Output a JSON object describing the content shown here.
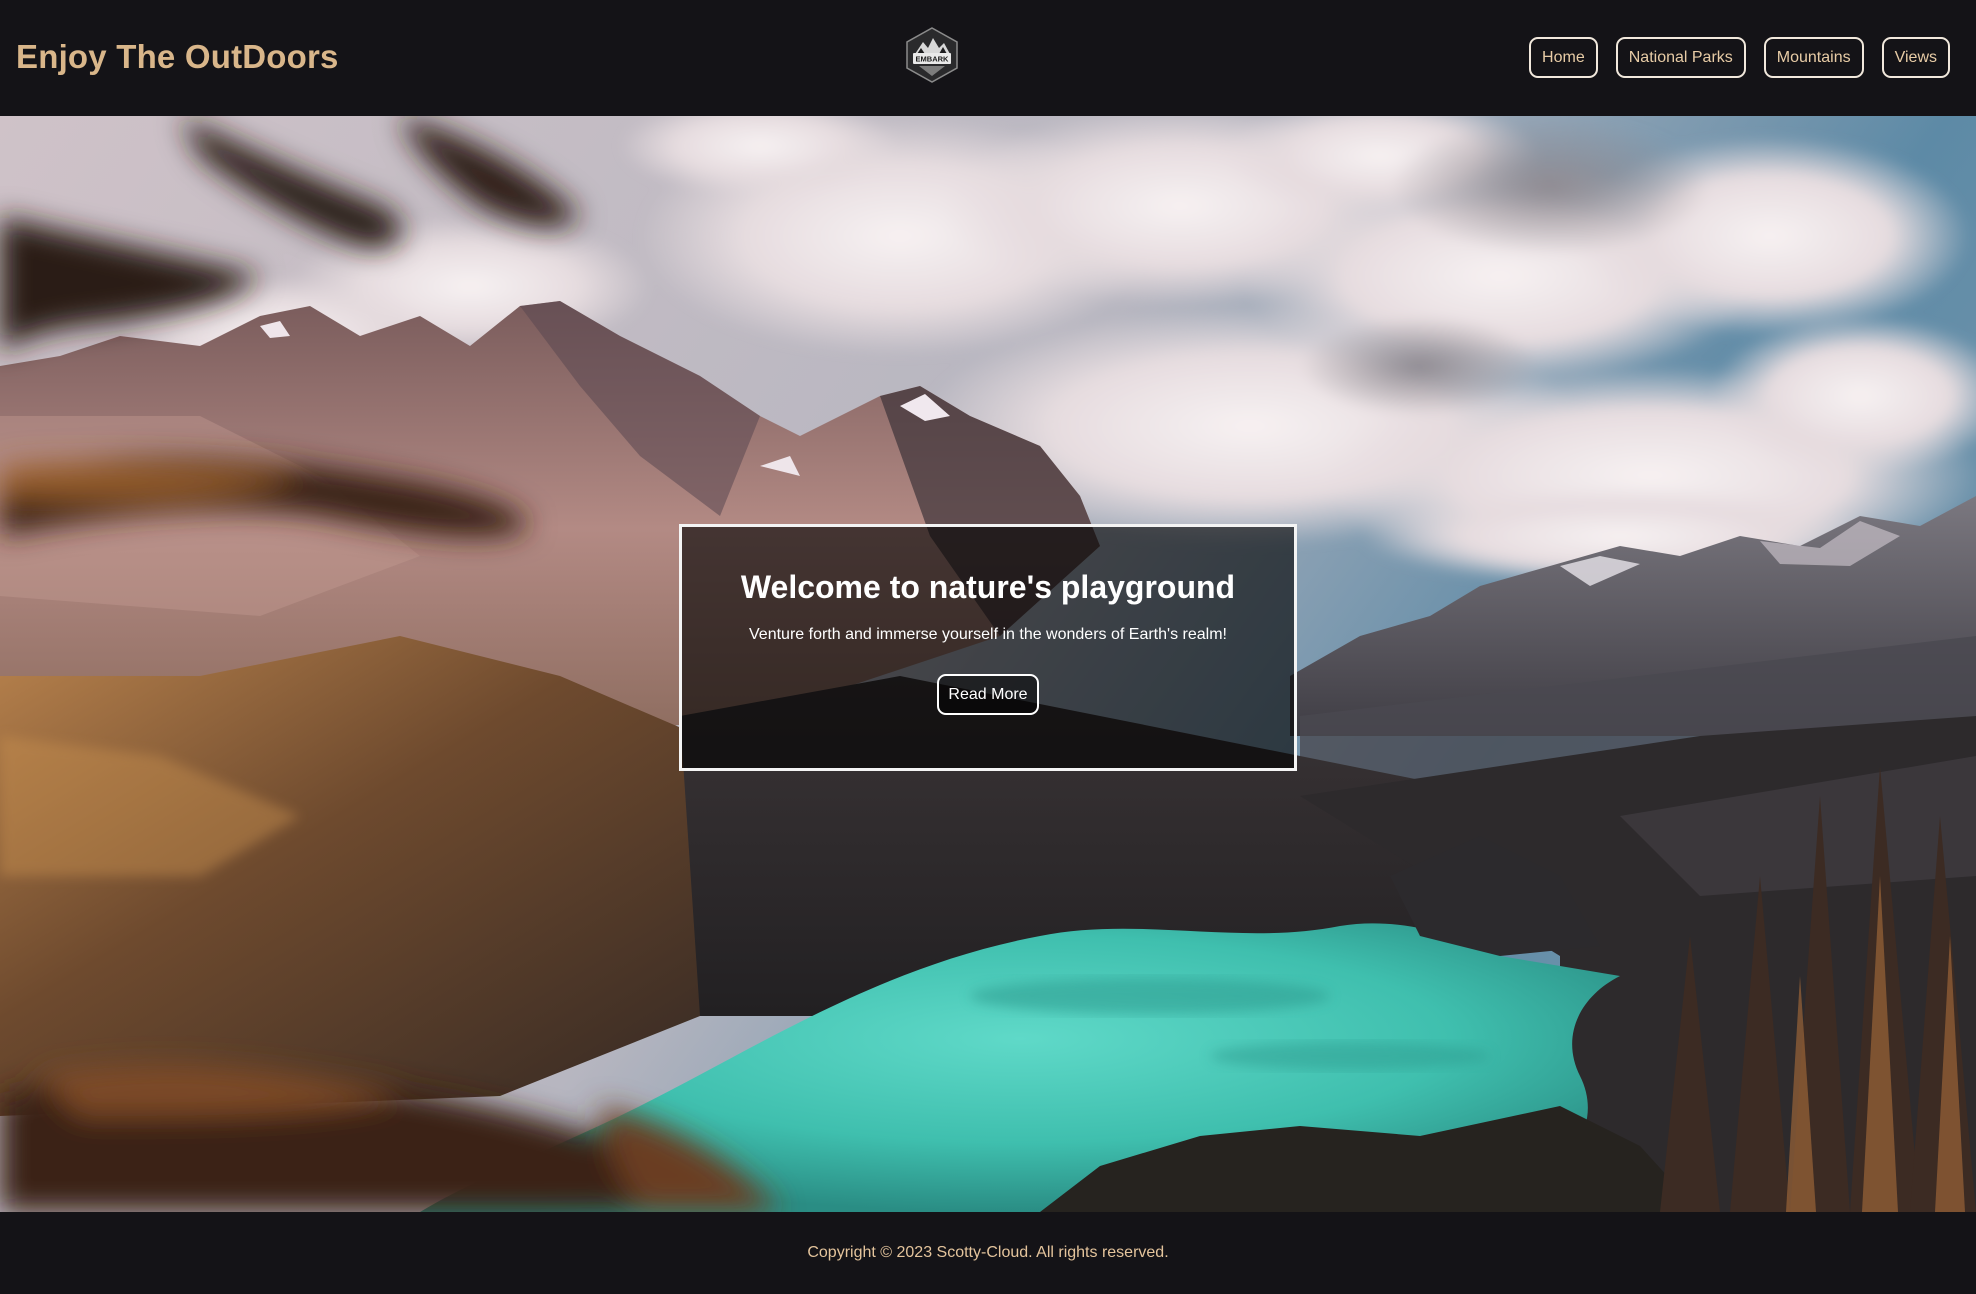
{
  "header": {
    "brand": "Enjoy The OutDoors",
    "logo_text": "EMBARK",
    "nav": [
      {
        "label": "Home"
      },
      {
        "label": "National Parks"
      },
      {
        "label": "Mountains"
      },
      {
        "label": "Views"
      }
    ]
  },
  "hero": {
    "title": "Welcome to nature's playground",
    "subtitle": "Venture forth and immerse yourself in the wonders of Earth's realm!",
    "button_label": "Read More"
  },
  "footer": {
    "copyright": "Copyright © 2023 Scotty-Cloud. All rights reserved."
  },
  "colors": {
    "background": "#141317",
    "brand": "#d9b68a",
    "nav_text": "#e8cca6",
    "lake": "#3fc4b4"
  }
}
